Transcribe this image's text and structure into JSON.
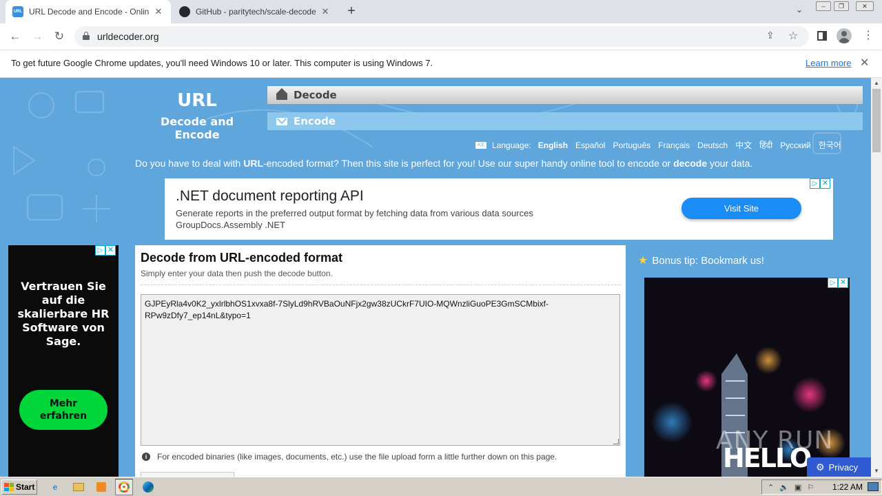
{
  "browser": {
    "tabs": [
      {
        "favicon_label": "URL",
        "title": "URL Decode and Encode - Online",
        "active": true
      },
      {
        "favicon_label": "",
        "title": "GitHub - paritytech/scale-decode: Dec",
        "active": false
      }
    ],
    "new_tab_symbol": "+",
    "url": "urldecoder.org",
    "infobar": {
      "message": "To get future Google Chrome updates, you'll need Windows 10 or later. This computer is using Windows 7.",
      "learn_more": "Learn more"
    }
  },
  "site": {
    "logo_line1": "URL",
    "logo_line2": "Decode and Encode",
    "nav": {
      "decode": "Decode",
      "encode": "Encode"
    },
    "language_label": "Language:",
    "languages": [
      "English",
      "Español",
      "Português",
      "Français",
      "Deutsch",
      "中文",
      "हिंदी",
      "Русский",
      "한국어"
    ],
    "current_language": "English",
    "tagline": {
      "part1": "Do you have to deal with ",
      "bold1": "URL",
      "part2": "-encoded format? Then this site is perfect for you! Use our super handy online tool to encode or ",
      "bold2": "decode",
      "part3": " your data."
    },
    "ad_top": {
      "headline": ".NET document reporting API",
      "line1": "Generate reports in the preferred output format by fetching data from various data sources",
      "line2": "GroupDocs.Assembly .NET",
      "cta": "Visit Site"
    },
    "ad_left": {
      "text": "Vertrauen Sie auf die skalierbare HR Software von Sage.",
      "cta_line1": "Mehr",
      "cta_line2": "erfahren"
    },
    "decode_panel": {
      "heading": "Decode from URL-encoded format",
      "subheading": "Simply enter your data then push the decode button.",
      "input_value": "GJPEyRla4v0K2_yxlrlbhOS1xvxa8f-7SlyLd9hRVBaOuNFjx2gw38zUCkrF7UIO-MQWnzliGuoPE3GmSCMbixf-RPw9zDfy7_ep14nL&typo=1",
      "note": "For encoded binaries (like images, documents, etc.) use the file upload form a little further down on this page."
    },
    "bonus_tip": "Bonus tip: Bookmark us!",
    "ad_right": {
      "overlay_text": "HELLO",
      "watermark": "ANY RUN"
    },
    "privacy_label": "Privacy"
  },
  "taskbar": {
    "start_label": "Start",
    "clock": "1:22 AM",
    "colors": {
      "chrome_active": "#ffffff",
      "taskbar": "#d4d0c8"
    }
  },
  "colors": {
    "page_bg": "#5fa6dc",
    "cta_blue": "#1a8cf5",
    "cta_green": "#00d639",
    "privacy_blue": "#2f5ad1"
  }
}
